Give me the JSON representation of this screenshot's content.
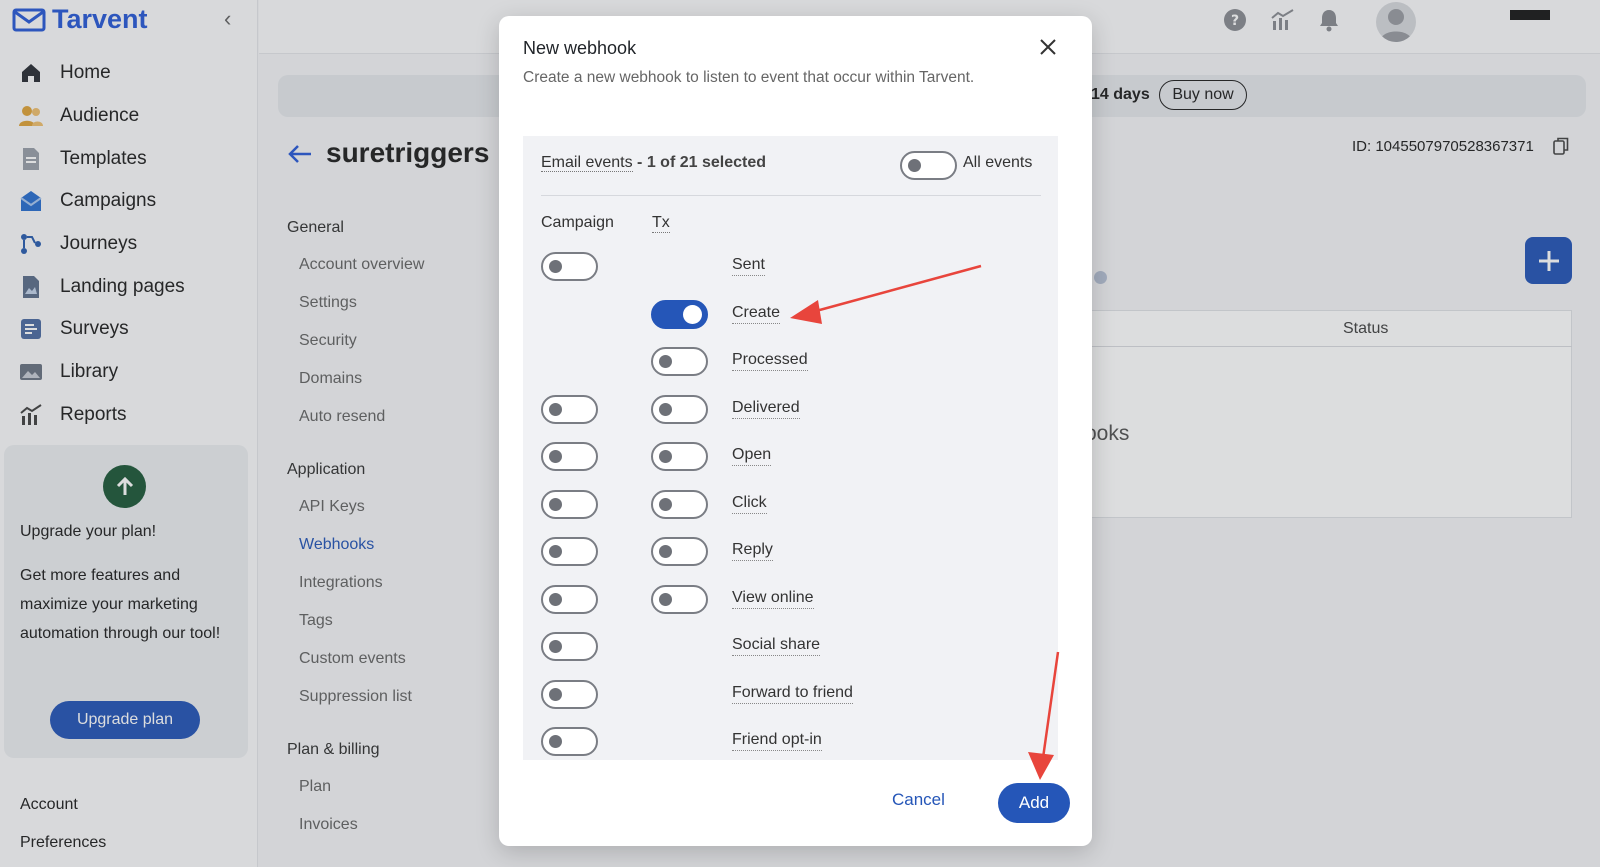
{
  "app": {
    "name": "Tarvent"
  },
  "sidebar": {
    "items": [
      {
        "label": "Home",
        "icon": "home-icon"
      },
      {
        "label": "Audience",
        "icon": "audience-icon"
      },
      {
        "label": "Templates",
        "icon": "templates-icon"
      },
      {
        "label": "Campaigns",
        "icon": "campaigns-icon"
      },
      {
        "label": "Journeys",
        "icon": "journeys-icon"
      },
      {
        "label": "Landing pages",
        "icon": "landing-pages-icon"
      },
      {
        "label": "Surveys",
        "icon": "surveys-icon"
      },
      {
        "label": "Library",
        "icon": "library-icon"
      },
      {
        "label": "Reports",
        "icon": "reports-icon"
      }
    ],
    "upgrade": {
      "title": "Upgrade your plan!",
      "text": "Get more features and maximize your marketing automation through our tool!",
      "button": "Upgrade plan"
    },
    "account": "Account",
    "preferences": "Preferences"
  },
  "header": {
    "trial_days": "14 days",
    "buy_now": "Buy now",
    "account_id": "ID: 1045507970528367371"
  },
  "page": {
    "title": "suretriggers",
    "settings_nav": {
      "general": "General",
      "general_items": [
        "Account overview",
        "Settings",
        "Security",
        "Domains",
        "Auto resend"
      ],
      "application": "Application",
      "application_items": [
        "API Keys",
        "Webhooks",
        "Integrations",
        "Tags",
        "Custom events",
        "Suppression list"
      ],
      "billing": "Plan & billing",
      "billing_items": [
        "Plan",
        "Invoices"
      ]
    },
    "table": {
      "status_header": "Status",
      "empty_fragment": "ooks"
    }
  },
  "modal": {
    "title": "New webhook",
    "description": "Create a new webhook to listen to event that occur within Tarvent.",
    "email_events": "Email events",
    "selected_count": "- 1 of 21 selected",
    "all_events": "All events",
    "col_campaign": "Campaign",
    "col_tx": "Tx",
    "events": [
      {
        "label": "Sent",
        "campaign": false,
        "tx": null
      },
      {
        "label": "Create",
        "campaign": null,
        "tx": true
      },
      {
        "label": "Processed",
        "campaign": null,
        "tx": false
      },
      {
        "label": "Delivered",
        "campaign": false,
        "tx": false
      },
      {
        "label": "Open",
        "campaign": false,
        "tx": false
      },
      {
        "label": "Click",
        "campaign": false,
        "tx": false
      },
      {
        "label": "Reply",
        "campaign": false,
        "tx": false
      },
      {
        "label": "View online",
        "campaign": false,
        "tx": false
      },
      {
        "label": "Social share",
        "campaign": false,
        "tx": null
      },
      {
        "label": "Forward to friend",
        "campaign": false,
        "tx": null
      },
      {
        "label": "Friend opt-in",
        "campaign": false,
        "tx": null
      }
    ],
    "cancel": "Cancel",
    "add": "Add"
  },
  "colors": {
    "primary": "#2556b8",
    "annotation": "#e8453c"
  }
}
